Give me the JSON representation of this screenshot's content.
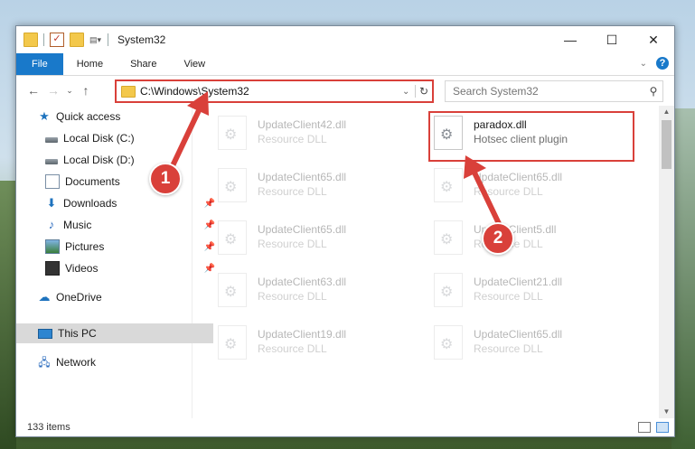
{
  "window": {
    "title": "System32",
    "controls": {
      "minimize": "—",
      "maximize": "☐",
      "close": "✕"
    }
  },
  "ribbon": {
    "tabs": [
      "File",
      "Home",
      "Share",
      "View"
    ]
  },
  "nav": {
    "address": "C:\\Windows\\System32",
    "search_placeholder": "Search System32"
  },
  "sidebar": {
    "items": [
      {
        "label": "Quick access",
        "icon": "star-icon",
        "pinned": false
      },
      {
        "label": "Local Disk (C:)",
        "icon": "drive-icon",
        "pinned": false
      },
      {
        "label": "Local Disk (D:)",
        "icon": "drive-icon",
        "pinned": false
      },
      {
        "label": "Documents",
        "icon": "documents-icon",
        "pinned": false
      },
      {
        "label": "Downloads",
        "icon": "download-icon",
        "pinned": true
      },
      {
        "label": "Music",
        "icon": "music-icon",
        "pinned": true
      },
      {
        "label": "Pictures",
        "icon": "pictures-icon",
        "pinned": true
      },
      {
        "label": "Videos",
        "icon": "videos-icon",
        "pinned": true
      },
      {
        "label": "OneDrive",
        "icon": "cloud-icon",
        "pinned": false
      },
      {
        "label": "This PC",
        "icon": "computer-icon",
        "pinned": false,
        "selected": true
      },
      {
        "label": "Network",
        "icon": "network-icon",
        "pinned": false
      }
    ]
  },
  "files": {
    "items": [
      {
        "name": "UpdateClient42.dll",
        "type": "Resource DLL",
        "faded": true
      },
      {
        "name": "paradox.dll",
        "type": "Hotsec client plugin",
        "faded": false,
        "highlighted": true
      },
      {
        "name": "UpdateClient65.dll",
        "type": "Resource DLL",
        "faded": true
      },
      {
        "name": "UpdateClient65.dll",
        "type": "Resource DLL",
        "faded": true
      },
      {
        "name": "UpdateClient65.dll",
        "type": "Resource DLL",
        "faded": true
      },
      {
        "name": "UpdateClient5.dll",
        "type": "Resource DLL",
        "faded": true
      },
      {
        "name": "UpdateClient63.dll",
        "type": "Resource DLL",
        "faded": true
      },
      {
        "name": "UpdateClient21.dll",
        "type": "Resource DLL",
        "faded": true
      },
      {
        "name": "UpdateClient19.dll",
        "type": "Resource DLL",
        "faded": true
      },
      {
        "name": "UpdateClient65.dll",
        "type": "Resource DLL",
        "faded": true
      }
    ]
  },
  "status": {
    "item_count": "133 items"
  },
  "annotations": {
    "step1": "1",
    "step2": "2",
    "color": "#d9403a"
  }
}
